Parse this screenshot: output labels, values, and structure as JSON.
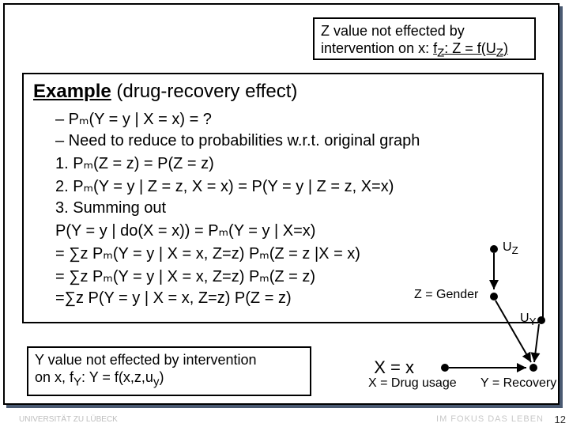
{
  "note_z": {
    "line1": "Z value not effected by",
    "line2_pre": "intervention on x: ",
    "line2_u1": "f",
    "line2_sub1": "Z",
    "line2_u2": ": Z = f(U",
    "line2_sub2": "Z",
    "line2_u3": ")"
  },
  "example": {
    "title_u": "Example",
    "title_rest": " (drug-recovery effect)",
    "lines": [
      "– Pₘ(Y = y | X = x) = ?",
      "– Need to reduce to probabilities w.r.t. original graph",
      "1.   Pₘ(Z = z) = P(Z = z)",
      "2.  Pₘ(Y = y | Z = z, X = x) = P(Y = y | Z = z, X=x)",
      "3.  Summing out",
      "P(Y = y | do(X = x)) = Pₘ(Y = y | X=x)",
      "= ∑z Pₘ(Y = y | X = x, Z=z) Pₘ(Z = z |X = x)",
      "= ∑z Pₘ(Y = y | X = x, Z=z) Pₘ(Z = z)",
      "=∑z P(Y = y | X = x, Z=z) P(Z = z)"
    ]
  },
  "note_y": {
    "line1": "Y value not effected by intervention",
    "line2": "on x, f",
    "line2_sub": "Y",
    "line2_rest": ": Y = f(x,z,u",
    "line2_sub2": "y",
    "line2_end": ")"
  },
  "diagram": {
    "uz": "U",
    "uz_sub": "Z",
    "uy": "U",
    "uy_sub": "Y",
    "z_label": "Z = Gender",
    "x_label": "X = Drug usage",
    "y_label": "Y = Recovery",
    "x_eq": "X = x"
  },
  "page_number": "12",
  "watermark": "IM FOKUS DAS LEBEN",
  "logo_text": "UNIVERSITÄT ZU LÜBECK"
}
